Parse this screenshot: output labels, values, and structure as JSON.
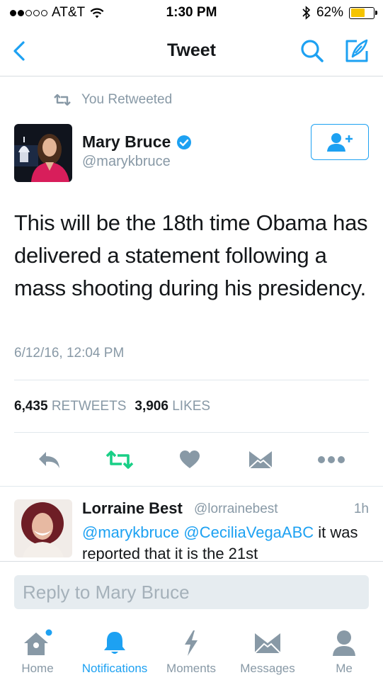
{
  "status_bar": {
    "carrier": "AT&T",
    "time": "1:30 PM",
    "battery": "62%",
    "battery_level": 0.62
  },
  "nav": {
    "title": "Tweet"
  },
  "tweet": {
    "retweet_context": "You Retweeted",
    "author_name": "Mary Bruce",
    "author_handle": "@marykbruce",
    "text": "This will be the 18th time Obama has delivered a statement following a mass shooting during his presidency.",
    "date": "6/12/16, 12:04 PM",
    "retweets_count": "6,435",
    "retweets_label": "RETWEETS",
    "likes_count": "3,906",
    "likes_label": "LIKES"
  },
  "reply": {
    "name": "Lorraine Best",
    "handle": "@lorrainebest",
    "time": "1h",
    "mention_1": "@marykbruce",
    "mention_2": "@CeciliaVegaABC",
    "text_rest": "it was reported that it is the 21st"
  },
  "reply_bar": {
    "placeholder": "Reply to Mary Bruce"
  },
  "tabs": [
    {
      "label": "Home",
      "icon": "home-icon",
      "active": false
    },
    {
      "label": "Notifications",
      "icon": "bell-icon",
      "active": true
    },
    {
      "label": "Moments",
      "icon": "lightning-icon",
      "active": false
    },
    {
      "label": "Messages",
      "icon": "envelope-icon",
      "active": false
    },
    {
      "label": "Me",
      "icon": "person-icon",
      "active": false
    }
  ],
  "colors": {
    "accent": "#1da1f2",
    "retweet_green": "#19cf86",
    "muted": "#8899a6",
    "icon_gray": "#8899a6",
    "battery_yellow": "#f5c400"
  }
}
